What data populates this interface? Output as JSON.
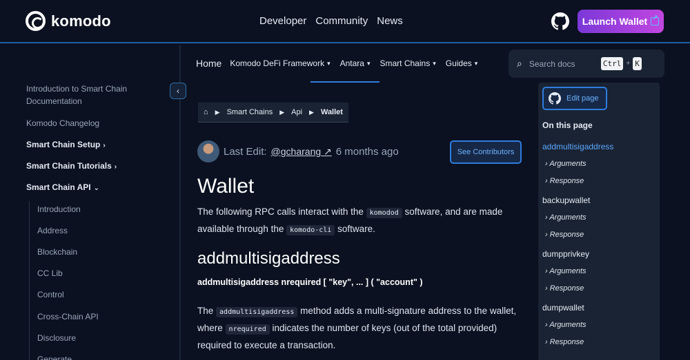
{
  "topnav": {
    "brand": "komodo",
    "links": [
      "Developer",
      "Community",
      "News"
    ],
    "launch_label": "Launch Wallet"
  },
  "sidebar": {
    "items": [
      {
        "label": "Introduction to Smart Chain Documentation"
      },
      {
        "label": "Komodo Changelog"
      },
      {
        "label": "Smart Chain Setup"
      },
      {
        "label": "Smart Chain Tutorials"
      },
      {
        "label": "Smart Chain API"
      }
    ],
    "subitems": [
      "Introduction",
      "Address",
      "Blockchain",
      "CC Lib",
      "Control",
      "Cross-Chain API",
      "Disclosure",
      "Generate"
    ]
  },
  "subnav": {
    "home": "Home",
    "links": [
      "Komodo DeFi Framework",
      "Antara",
      "Smart Chains",
      "Guides"
    ]
  },
  "search": {
    "placeholder": "Search docs",
    "key1": "Ctrl",
    "plus": "+",
    "key2": "K"
  },
  "breadcrumb": [
    "Smart Chains",
    "Api",
    "Wallet"
  ],
  "edit": {
    "label": "Last Edit:",
    "user": "@gcharang",
    "arrow": "↗",
    "time": "6 months ago",
    "contributors_label": "See Contributors"
  },
  "content": {
    "title": "Wallet",
    "intro_1": "The following RPC calls interact with the",
    "intro_code_1": "komodod",
    "intro_2": "software, and are made available through the",
    "intro_code_2": "komodo-cli",
    "intro_3": "software.",
    "section_title": "addmultisigaddress",
    "signature": "addmultisigaddress nrequired [ \"key\", ... ] ( \"account\" )",
    "desc_1": "The",
    "desc_code_1": "addmultisigaddress",
    "desc_2": "method adds a multi-signature address to the wallet, where",
    "desc_code_2": "nrequired",
    "desc_3": "indicates the number of keys (out of the total provided) required to execute a transaction."
  },
  "toc": {
    "edit_label": "Edit page",
    "title": "On this page",
    "entries": [
      {
        "label": "addmultisigaddress",
        "subs": [
          "Arguments",
          "Response"
        ]
      },
      {
        "label": "backupwallet",
        "subs": [
          "Arguments",
          "Response"
        ]
      },
      {
        "label": "dumpprivkey",
        "subs": [
          "Arguments",
          "Response"
        ]
      },
      {
        "label": "dumpwallet",
        "subs": [
          "Arguments",
          "Response"
        ]
      }
    ]
  }
}
